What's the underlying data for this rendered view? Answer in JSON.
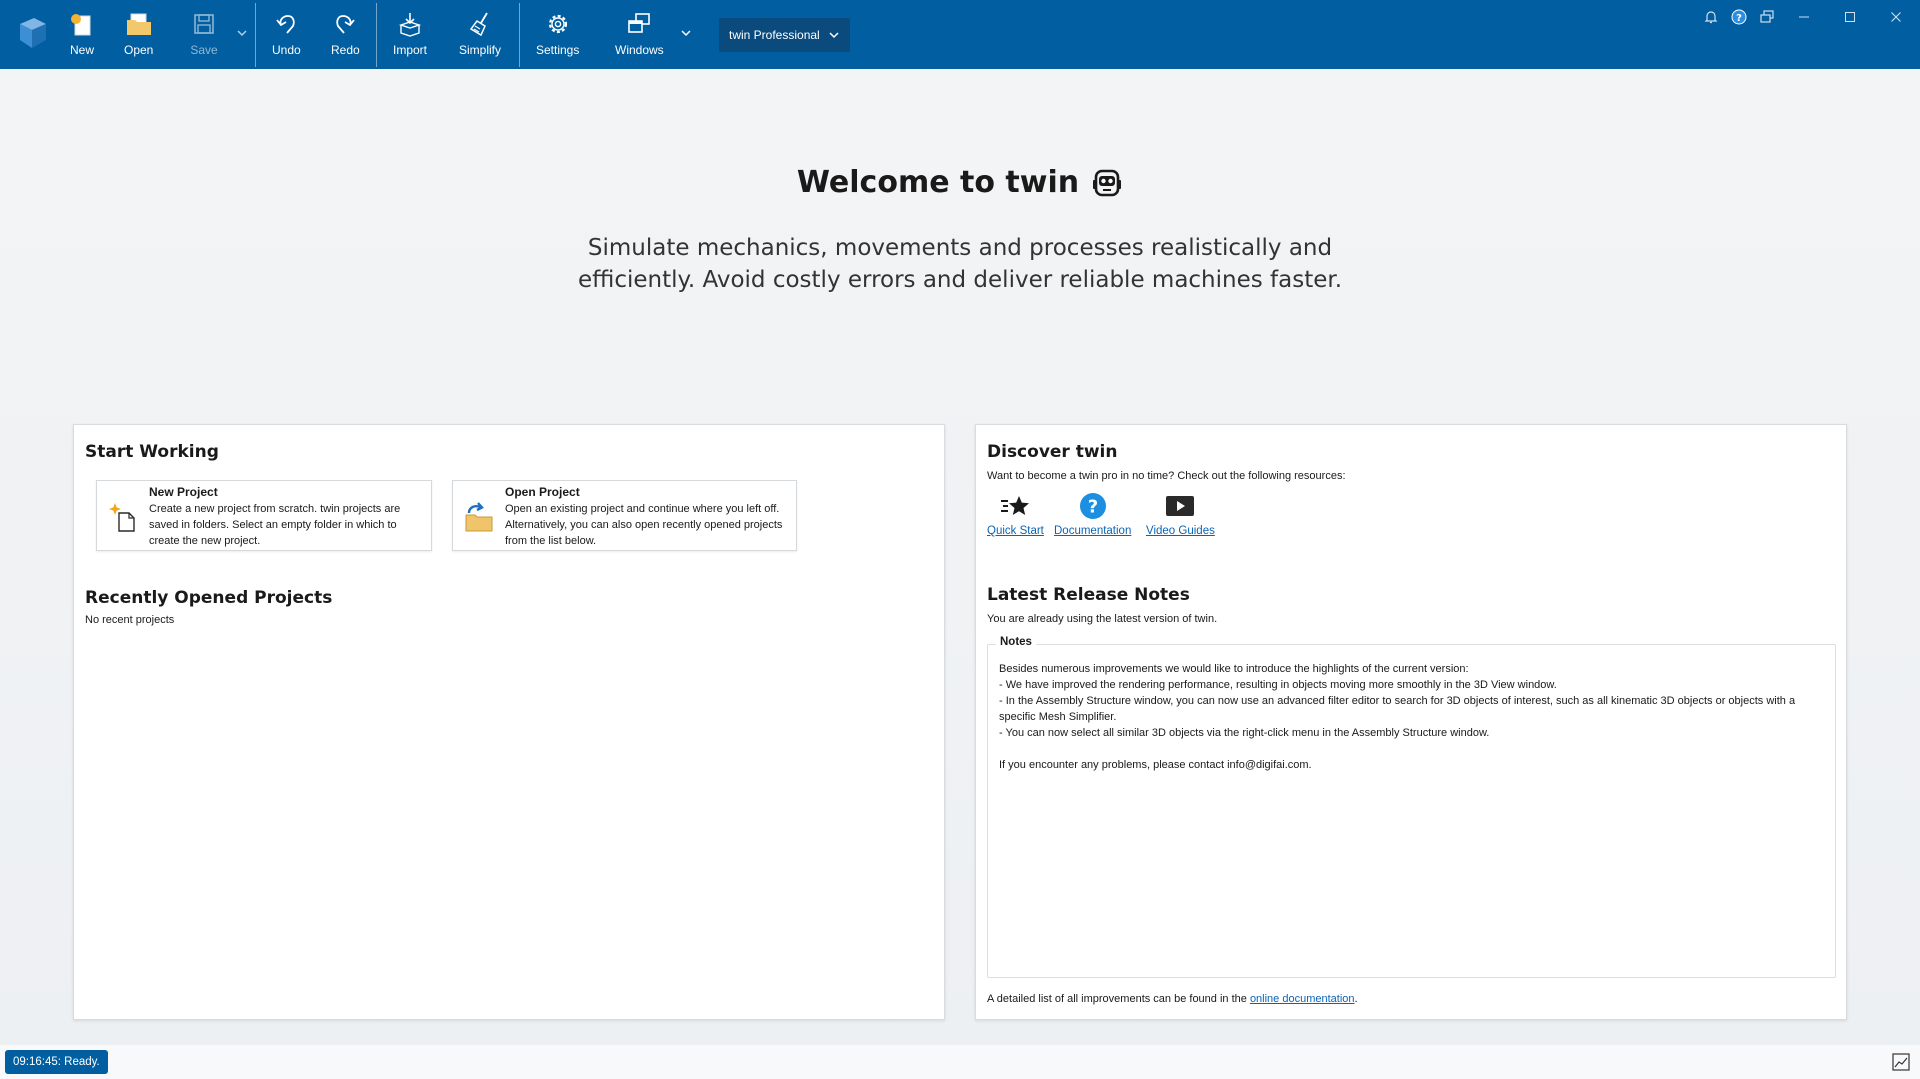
{
  "toolbar": {
    "new": "New",
    "open": "Open",
    "save": "Save",
    "undo": "Undo",
    "redo": "Redo",
    "import": "Import",
    "simplify": "Simplify",
    "settings": "Settings",
    "windows": "Windows",
    "edition": "twin Professional",
    "accent": "#015ea0"
  },
  "welcome": {
    "title": "Welcome to twin",
    "tagline": "Simulate mechanics, movements and processes realistically and efficiently. Avoid costly errors and deliver reliable machines faster."
  },
  "start_working": {
    "heading": "Start Working",
    "new_project": {
      "title": "New Project",
      "desc": "Create a new project from scratch. twin projects are saved in folders. Select an empty folder in which to create the new project."
    },
    "open_project": {
      "title": "Open Project",
      "desc": "Open an existing project and continue where you left off. Alternatively, you can also open recently opened projects from the list below."
    },
    "recent_heading": "Recently Opened Projects",
    "recent_empty": "No recent projects"
  },
  "discover": {
    "heading": "Discover twin",
    "intro": "Want to become a twin pro in no time? Check out the following resources:",
    "resources": [
      {
        "label": "Quick Start",
        "icon": "quick-start-icon"
      },
      {
        "label": "Documentation",
        "icon": "help-icon"
      },
      {
        "label": "Video Guides",
        "icon": "video-icon"
      }
    ],
    "release_heading": "Latest Release Notes",
    "release_status": "You are already using the latest version of twin.",
    "notes_label": "Notes",
    "notes_text": "Besides numerous improvements we would like to introduce the highlights of the current version:\n- We have improved the rendering performance, resulting in objects moving more smoothly in the 3D View window.\n- In the Assembly Structure window, you can now use an advanced filter editor to search for 3D objects of interest, such as all kinematic 3D objects or objects with a specific Mesh Simplifier.\n- You can now select all similar 3D objects via the right-click menu in the Assembly Structure window.\n\nIf you encounter any problems, please contact info@digifai.com.",
    "footer_pre": "A detailed list of all improvements can be found in the ",
    "footer_link": "online documentation",
    "footer_post": "."
  },
  "status": {
    "text": "09:16:45: Ready."
  }
}
